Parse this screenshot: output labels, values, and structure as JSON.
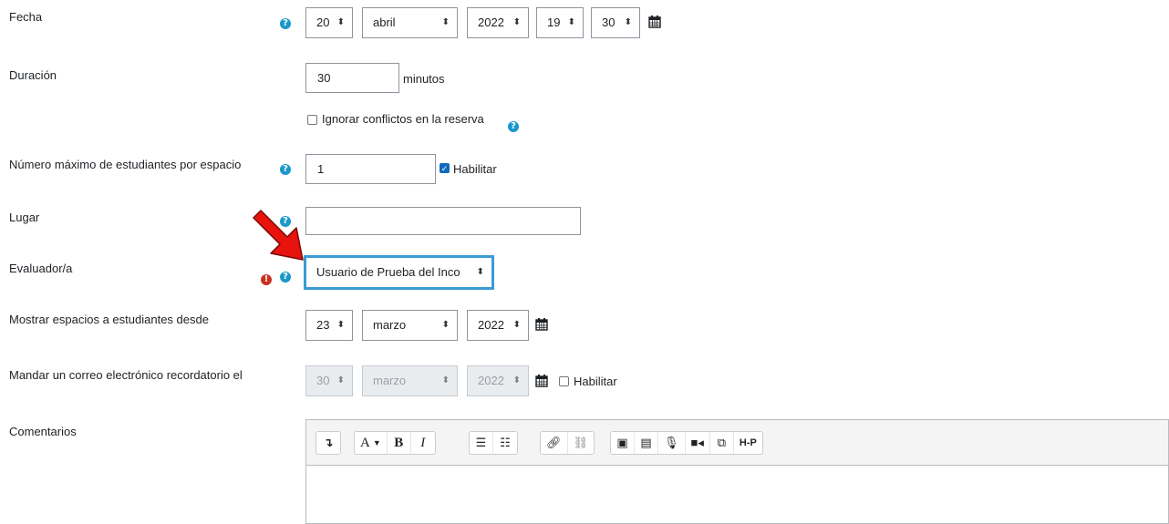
{
  "fecha": {
    "label": "Fecha",
    "day": "20",
    "month": "abril",
    "year": "2022",
    "hour": "19",
    "minute": "30"
  },
  "duracion": {
    "label": "Duración",
    "value": "30",
    "unit": "minutos"
  },
  "conflictos": {
    "label": "Ignorar conflictos en la reserva",
    "checked": false
  },
  "max_estudiantes": {
    "label": "Número máximo de estudiantes por espacio",
    "value": "1",
    "enable_label": "Habilitar",
    "enabled": true
  },
  "lugar": {
    "label": "Lugar",
    "value": ""
  },
  "evaluador": {
    "label": "Evaluador/a",
    "value": "Usuario de Prueba del Inco"
  },
  "mostrar_desde": {
    "label": "Mostrar espacios a estudiantes desde",
    "day": "23",
    "month": "marzo",
    "year": "2022"
  },
  "recordatorio": {
    "label": "Mandar un correo electrónico recordatorio el",
    "day": "30",
    "month": "marzo",
    "year": "2022",
    "enable_label": "Habilitar",
    "enabled": false
  },
  "comentarios": {
    "label": "Comentarios",
    "toolbar": {
      "bold": "B",
      "italic": "I",
      "font": "A",
      "h5p": "H-P"
    }
  },
  "colors": {
    "help": "#1a98c9",
    "error": "#ca3120",
    "focus": "#3a9bd3",
    "arrow": "#e8130d"
  },
  "icons": [
    "help-icon",
    "error-icon",
    "calendar-icon",
    "red-arrow"
  ]
}
